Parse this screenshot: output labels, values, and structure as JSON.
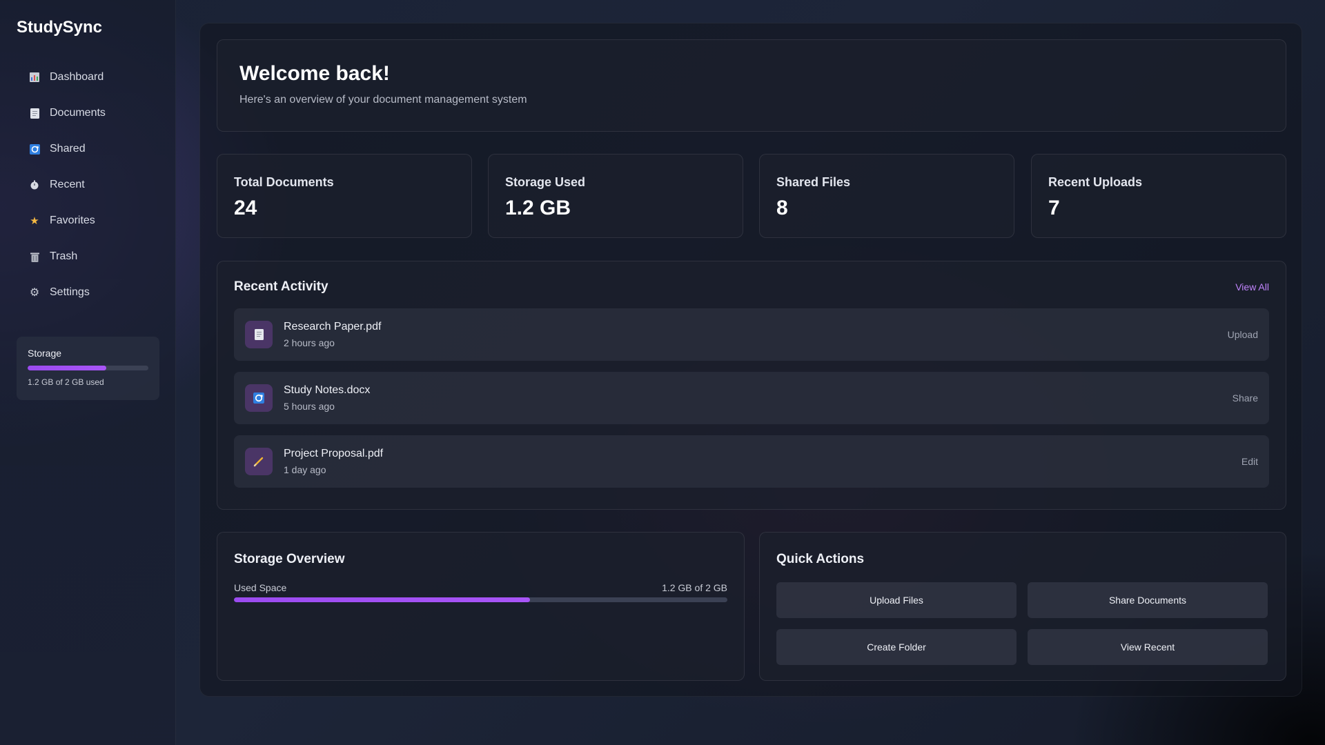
{
  "app": {
    "name": "StudySync"
  },
  "sidebar": {
    "items": [
      {
        "label": "Dashboard",
        "icon": "chart-icon"
      },
      {
        "label": "Documents",
        "icon": "document-icon"
      },
      {
        "label": "Shared",
        "icon": "shared-icon"
      },
      {
        "label": "Recent",
        "icon": "clock-icon"
      },
      {
        "label": "Favorites",
        "icon": "star-icon"
      },
      {
        "label": "Trash",
        "icon": "trash-icon"
      },
      {
        "label": "Settings",
        "icon": "gear-icon"
      }
    ],
    "storage": {
      "title": "Storage",
      "used_fraction": 0.65,
      "summary": "1.2 GB of 2 GB used"
    }
  },
  "welcome": {
    "title": "Welcome back!",
    "subtitle": "Here's an overview of your document management system"
  },
  "stats": [
    {
      "label": "Total Documents",
      "value": "24"
    },
    {
      "label": "Storage Used",
      "value": "1.2 GB"
    },
    {
      "label": "Shared Files",
      "value": "8"
    },
    {
      "label": "Recent Uploads",
      "value": "7"
    }
  ],
  "activity": {
    "title": "Recent Activity",
    "view_all": "View All",
    "items": [
      {
        "name": "Research Paper.pdf",
        "time": "2 hours ago",
        "action": "Upload",
        "icon": "document-icon"
      },
      {
        "name": "Study Notes.docx",
        "time": "5 hours ago",
        "action": "Share",
        "icon": "shared-icon"
      },
      {
        "name": "Project Proposal.pdf",
        "time": "1 day ago",
        "action": "Edit",
        "icon": "pencil-icon"
      }
    ]
  },
  "storage_overview": {
    "title": "Storage Overview",
    "label": "Used Space",
    "value": "1.2 GB of 2 GB",
    "used_fraction": 0.6
  },
  "quick_actions": {
    "title": "Quick Actions",
    "buttons": [
      "Upload Files",
      "Share Documents",
      "Create Folder",
      "View Recent"
    ]
  },
  "colors": {
    "accent": "#a855f7",
    "link": "#c084fc"
  }
}
